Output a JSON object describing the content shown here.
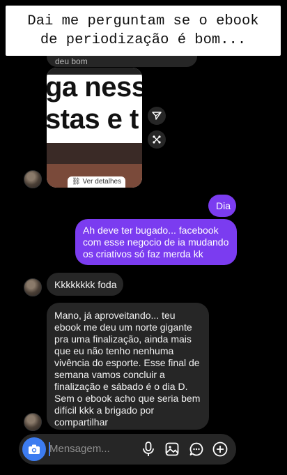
{
  "caption": {
    "line1": "Dai me perguntam se o ebook",
    "line2": "de periodização é bom..."
  },
  "media_message": {
    "overlay_text_line1": "ga ness",
    "overlay_text_line2": "stas e t",
    "link_label": "Ver detalhes",
    "partial_above": "deu bom"
  },
  "messages": [
    {
      "side": "out",
      "text": "Dia"
    },
    {
      "side": "out",
      "text": "Ah deve ter bugado... facebook com esse negocio de ia mudando os criativos só faz merda kk"
    },
    {
      "side": "in",
      "text": "Kkkkkkkk foda"
    },
    {
      "side": "in",
      "text": "Mano, já aproveitando... teu ebook me deu um norte gigante pra uma finalização, ainda mais que eu não tenho nenhuma vivência do esporte. Esse final de semana vamos concluir a finalização e sábado é o dia D. Sem o ebook acho que seria bem difícil kkk a brigado por compartilhar"
    }
  ],
  "composer": {
    "placeholder": "Mensagem..."
  },
  "colors": {
    "outgoing_bubble": "#7b3cf0",
    "incoming_bubble": "#262626",
    "camera_button": "#3d7cf0"
  },
  "icons": [
    "share-icon",
    "forward-icon",
    "camera-icon",
    "microphone-icon",
    "image-icon",
    "sticker-icon",
    "plus-icon",
    "link-icon"
  ]
}
